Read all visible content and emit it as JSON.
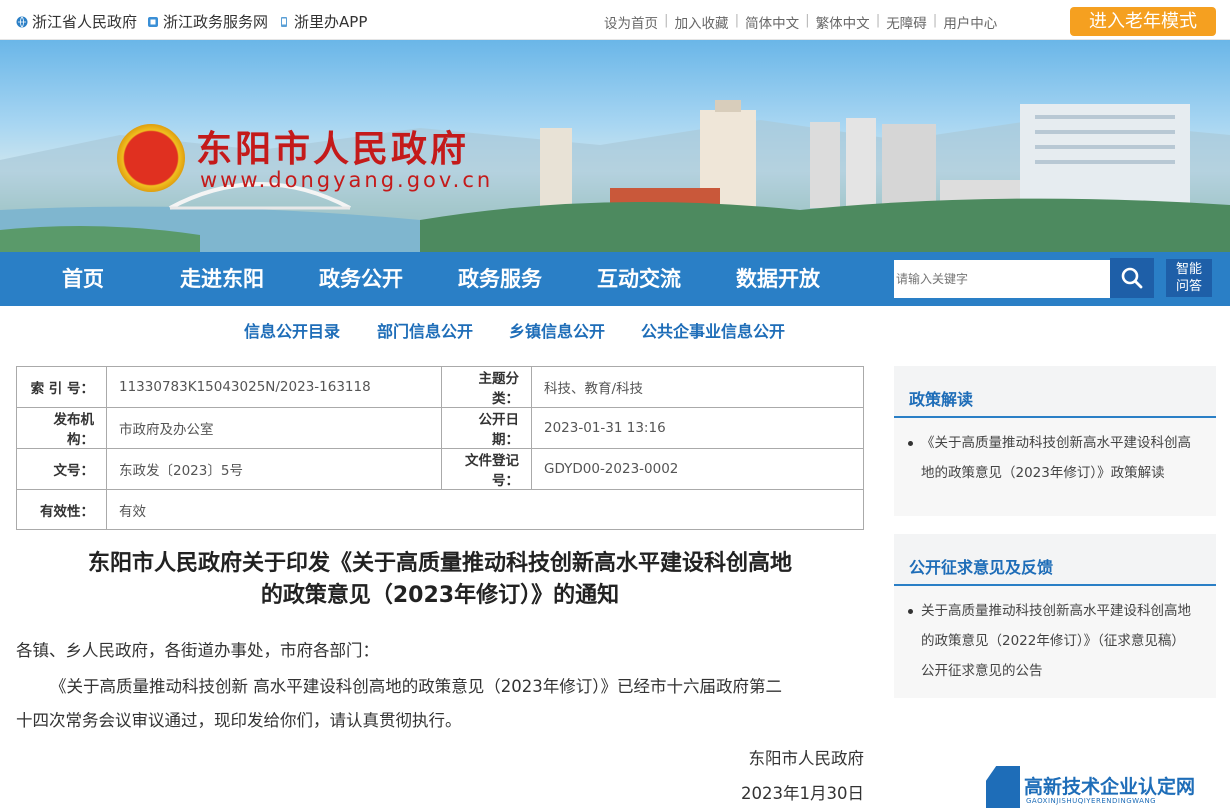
{
  "topbar": {
    "left_links": [
      "浙江省人民政府",
      "浙江政务服务网",
      "浙里办APP"
    ],
    "right_links": [
      "设为首页",
      "加入收藏",
      "简体中文",
      "繁体中文",
      "无障碍",
      "用户中心"
    ],
    "elder_mode": "进入老年模式"
  },
  "banner": {
    "title": "东阳市人民政府",
    "url": "www.dongyang.gov.cn"
  },
  "nav": {
    "items": [
      "首页",
      "走进东阳",
      "政务公开",
      "政务服务",
      "互动交流",
      "数据开放"
    ],
    "search_placeholder": "请输入关键字",
    "smart_line1": "智能",
    "smart_line2": "问答"
  },
  "subnav": {
    "items": [
      "信息公开目录",
      "部门信息公开",
      "乡镇信息公开",
      "公共企事业信息公开"
    ]
  },
  "info": {
    "index_label": "索 引 号：",
    "index_value": "11330783K15043025N/2023-163118",
    "topic_label": "主题分类：",
    "topic_value": "科技、教育/科技",
    "publisher_label": "发布机构：",
    "publisher_value": "市政府及办公室",
    "date_label": "公开日期：",
    "date_value": "2023-01-31 13:16",
    "docno_label": "文号：",
    "docno_value": "东政发〔2023〕5号",
    "reg_label": "文件登记号：",
    "reg_value": "GDYD00-2023-0002",
    "validity_label": "有效性：",
    "validity_value": "有效"
  },
  "article": {
    "title_line1": "东阳市人民政府关于印发《关于高质量推动科技创新高水平建设科创高地",
    "title_line2": "的政策意见（2023年修订）》的通知",
    "salutation": "各镇、乡人民政府，各街道办事处，市府各部门：",
    "body_line1": "《关于高质量推动科技创新 高水平建设科创高地的政策意见（2023年修订）》已经市十六届政府第二",
    "body_line2": "十四次常务会议审议通过，现印发给你们，请认真贯彻执行。",
    "signer": "东阳市人民政府",
    "sign_date": "2023年1月30日"
  },
  "sidebar": {
    "interpretation_title": "政策解读",
    "interpretation_item": "《关于高质量推动科技创新高水平建设科创高地的政策意见（2023年修订）》政策解读",
    "consult_title": "公开征求意见及反馈",
    "consult_item": "关于高质量推动科技创新高水平建设科创高地的政策意见（2022年修订）》（征求意见稿）公开征求意见的公告"
  },
  "watermark": {
    "text": "高新技术企业认定网",
    "sub": "GAOXINJISHUQIYERENDINGWANG"
  }
}
